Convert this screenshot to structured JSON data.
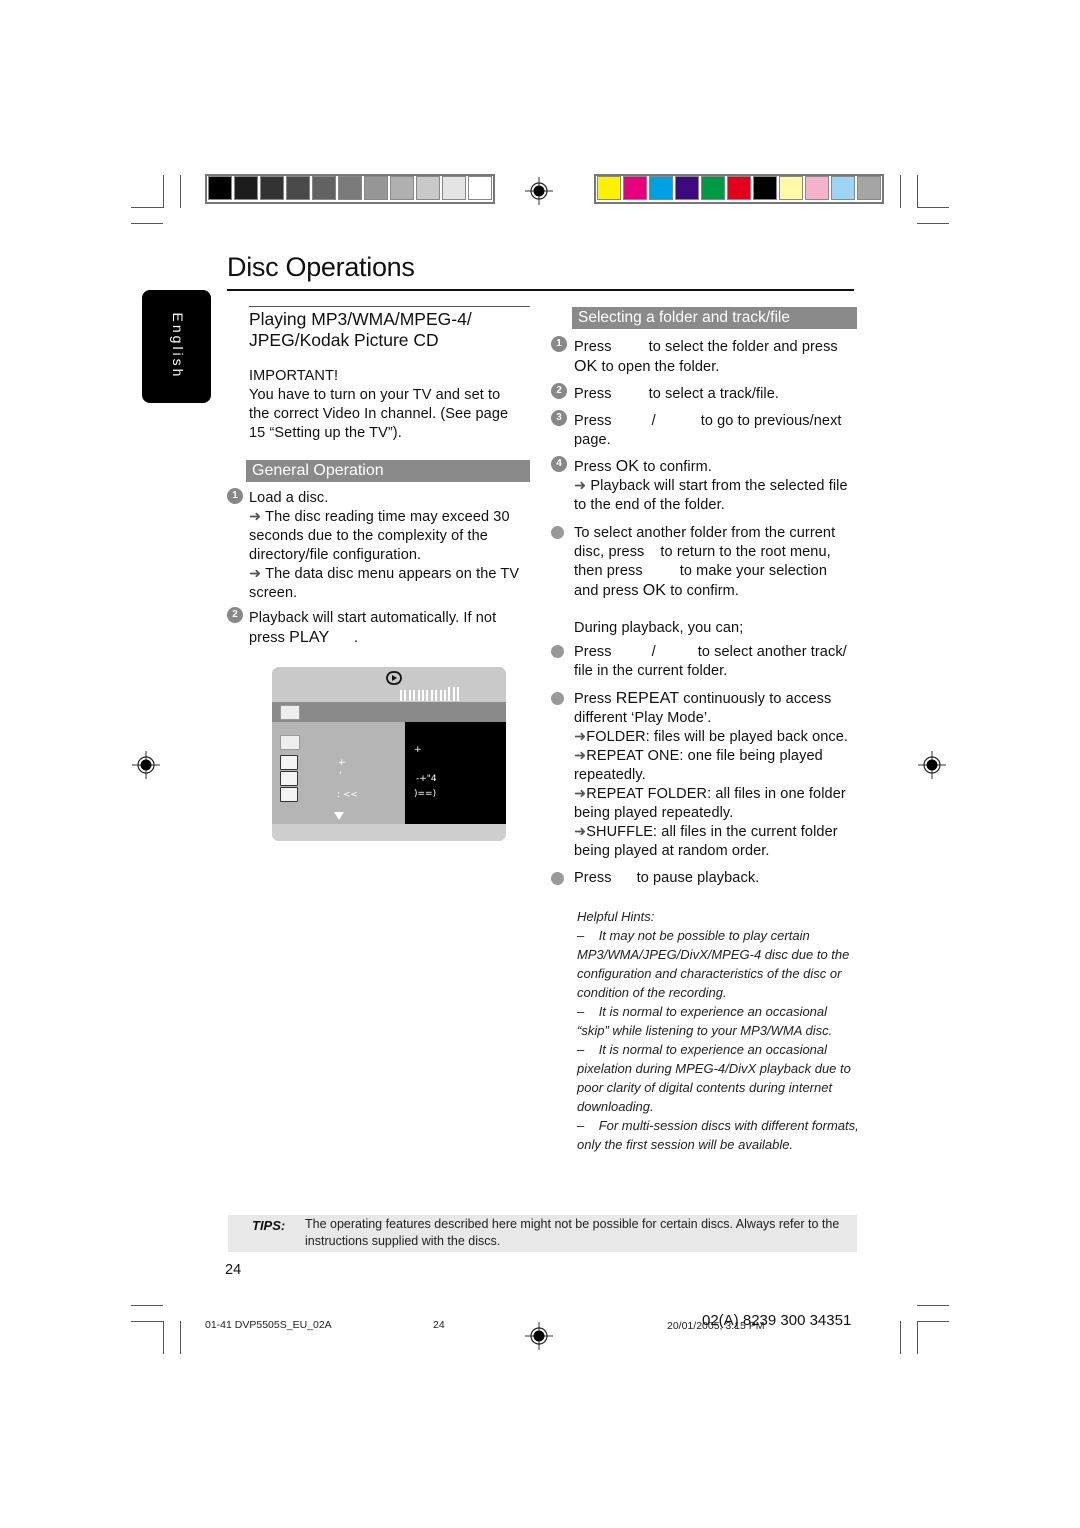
{
  "page": {
    "title": "Disc Operations",
    "language_tab": "English",
    "page_number": "24"
  },
  "colors": {
    "grayscale_bar": [
      "#000000",
      "#1c1c1c",
      "#333333",
      "#4a4a4a",
      "#626262",
      "#7a7a7a",
      "#969696",
      "#b0b0b0",
      "#c9c9c9",
      "#e4e4e4",
      "#ffffff"
    ],
    "color_bar": [
      "#fff200",
      "#e6007e",
      "#00a0e4",
      "#3d0a7d",
      "#009a44",
      "#e2001a",
      "#000000",
      "#fff9a8",
      "#f6b2cb",
      "#9dd6f5",
      "#a5a5a5"
    ],
    "section_bar": "#8a8a8a",
    "tips_bg": "#e8e8e8"
  },
  "left": {
    "heading_line1": "Playing MP3/WMA/MPEG-4/",
    "heading_line2": "JPEG/Kodak Picture CD",
    "important_label": "IMPORTANT!",
    "important_text": "You have to turn on your TV and set to the correct Video In channel. (See page 15 “Setting up the TV”).",
    "section_title": "General Operation",
    "steps": [
      {
        "num": "1",
        "text": "Load a disc.",
        "notes": [
          "The disc reading time may exceed 30 seconds due to the complexity of the directory/file configuration.",
          "The data disc menu appears on the TV screen."
        ]
      },
      {
        "num": "2",
        "text_pre": "Playback will start automatically. If not press ",
        "text_key": "PLAY",
        "text_post": "      ."
      }
    ],
    "tv_screen": {
      "icon": "play-circle-icon",
      "left_marks": [
        "+",
        "'",
        ": <<"
      ],
      "right_marks": [
        "+",
        "-+\"4",
        ")==)"
      ],
      "scroll_icon": "down-triangle-icon"
    }
  },
  "right": {
    "section_title": "Selecting a folder and track/file",
    "steps": [
      {
        "num": "1",
        "pre": "Press",
        "post": "to select the folder and press",
        "line2_key": "OK",
        "line2": "to open the folder."
      },
      {
        "num": "2",
        "pre": "Press",
        "post": "to select a track/file."
      },
      {
        "num": "3",
        "pre": "Press",
        "sep": "/",
        "post": "to go to previous/next",
        "line2": "page."
      },
      {
        "num": "4",
        "pre": "Press",
        "key": "OK",
        "post": "to confirm.",
        "note": "Playback will start from the selected file to the end of the folder."
      }
    ],
    "another_folder": {
      "line1": "To select another folder from the current",
      "line2_pre": "disc, press",
      "line2_post": "to return to the root menu,",
      "line3_pre": "then press",
      "line3_post": "to make your selection",
      "line4_pre": "and press",
      "line4_key": "OK",
      "line4_post": "to confirm."
    },
    "during_playback": "During playback, you can;",
    "bullets": {
      "select_track_pre": "Press",
      "select_track_sep": "/",
      "select_track_post": "to select another track/",
      "select_track_line2": "file in the current folder.",
      "repeat_pre": "Press",
      "repeat_key": "REPEAT",
      "repeat_post": "continuously to access",
      "repeat_line2": "different ‘Play Mode’.",
      "modes": [
        {
          "name": "FOLDER:",
          "desc": "files will be played back once."
        },
        {
          "name": "REPEAT ONE:",
          "desc": "one file being played repeatedly."
        },
        {
          "name": "REPEAT FOLDER:",
          "desc": "all files in one folder being played repeatedly."
        },
        {
          "name": "SHUFFLE:",
          "desc": "all files in the current folder being played at random order."
        }
      ],
      "pause_pre": "Press",
      "pause_post": "to pause playback."
    },
    "hints": {
      "title": "Helpful Hints:",
      "items": [
        "It may not be possible to play certain MP3/WMA/JPEG/DivX/MPEG-4 disc due to the configuration and characteristics of the disc or condition of the recording.",
        "It is normal to experience an occasional “skip” while listening to your MP3/WMA disc.",
        "It is normal to experience an occasional pixelation during MPEG-4/DivX playback due to poor clarity of digital contents during internet downloading.",
        "For multi-session discs with different formats, only the first session will be available."
      ]
    }
  },
  "tips": {
    "label": "TIPS:",
    "text": "The operating features described here might not be possible for certain discs.  Always refer to the instructions supplied with the discs."
  },
  "footer": {
    "file_code": "01-41 DVP5505S_EU_02A",
    "page": "24",
    "timestamp": "20/01/2005, 3:15 PM",
    "part_number": "02(A) 8239 300 34351"
  }
}
